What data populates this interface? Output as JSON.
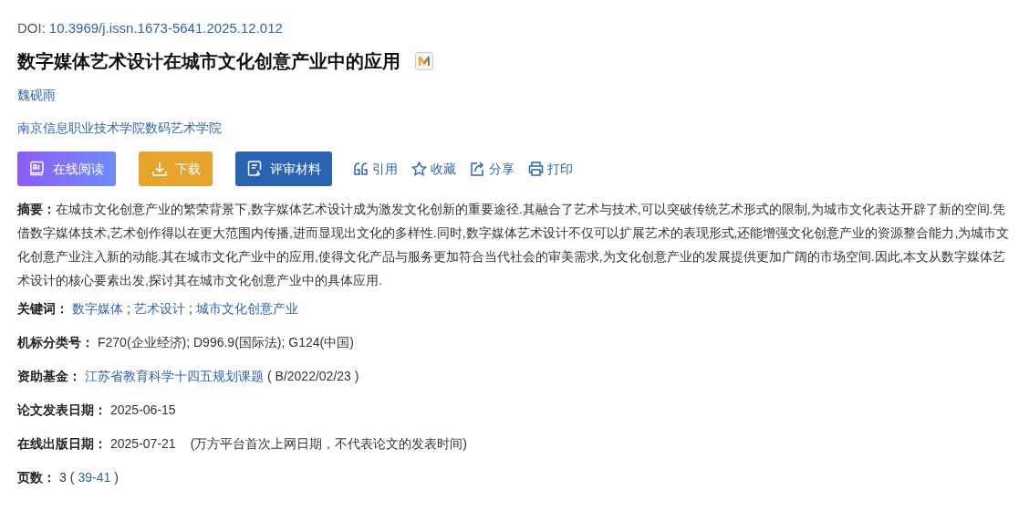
{
  "doi": {
    "label": "DOI:",
    "value": "10.3969/j.issn.1673-5641.2025.12.012"
  },
  "title": "数字媒体艺术设计在城市文化创意产业中的应用",
  "author": "魏砚雨",
  "affiliation": "南京信息职业技术学院数码艺术学院",
  "buttons": [
    {
      "kind": "read",
      "label": "在线阅读"
    },
    {
      "kind": "download",
      "label": "下载"
    },
    {
      "kind": "review",
      "label": "评审材料"
    }
  ],
  "actions": [
    {
      "kind": "cite",
      "label": "引用"
    },
    {
      "kind": "favorite",
      "label": "收藏"
    },
    {
      "kind": "share",
      "label": "分享"
    },
    {
      "kind": "print",
      "label": "打印"
    }
  ],
  "abstract": {
    "label": "摘要：",
    "text": "在城市文化创意产业的繁荣背景下,数字媒体艺术设计成为激发文化创新的重要途径.其融合了艺术与技术,可以突破传统艺术形式的限制,为城市文化表达开辟了新的空间.凭借数字媒体技术,艺术创作得以在更大范围内传播,进而显现出文化的多样性.同时,数字媒体艺术设计不仅可以扩展艺术的表现形式,还能增强文化创意产业的资源整合能力,为城市文化创意产业注入新的动能.其在城市文化产业中的应用,使得文化产品与服务更加符合当代社会的审美需求,为文化创意产业的发展提供更加广阔的市场空间.因此,本文从数字媒体艺术设计的核心要素出发,探讨其在城市文化创意产业中的具体应用."
  },
  "fields": [
    {
      "label": "关键词：",
      "parts": [
        {
          "kind": "link",
          "text": "数字媒体"
        },
        {
          "kind": "text",
          "text": ";"
        },
        {
          "kind": "link",
          "text": "艺术设计"
        },
        {
          "kind": "text",
          "text": ";"
        },
        {
          "kind": "link",
          "text": "城市文化创意产业"
        }
      ]
    },
    {
      "label": "机标分类号：",
      "parts": [
        {
          "kind": "text",
          "text": "F270(企业经济); D996.9(国际法); G124(中国)"
        }
      ]
    },
    {
      "label": "资助基金：",
      "parts": [
        {
          "kind": "link",
          "text": "江苏省教育科学十四五规划课题"
        },
        {
          "kind": "text",
          "text": "( B/2022/02/23 )"
        }
      ]
    },
    {
      "label": "论文发表日期：",
      "parts": [
        {
          "kind": "text",
          "text": "2025-06-15"
        }
      ]
    },
    {
      "label": "在线出版日期：",
      "parts": [
        {
          "kind": "text",
          "text": "2025-07-21"
        },
        {
          "kind": "note",
          "text": "(万方平台首次上网日期，不代表论文的发表时间)"
        }
      ]
    },
    {
      "label": "页数：",
      "parts": [
        {
          "kind": "text",
          "text": "3"
        },
        {
          "kind": "text",
          "text": "("
        },
        {
          "kind": "link",
          "text": "39-41"
        },
        {
          "kind": "text",
          "text": ")"
        }
      ]
    }
  ]
}
